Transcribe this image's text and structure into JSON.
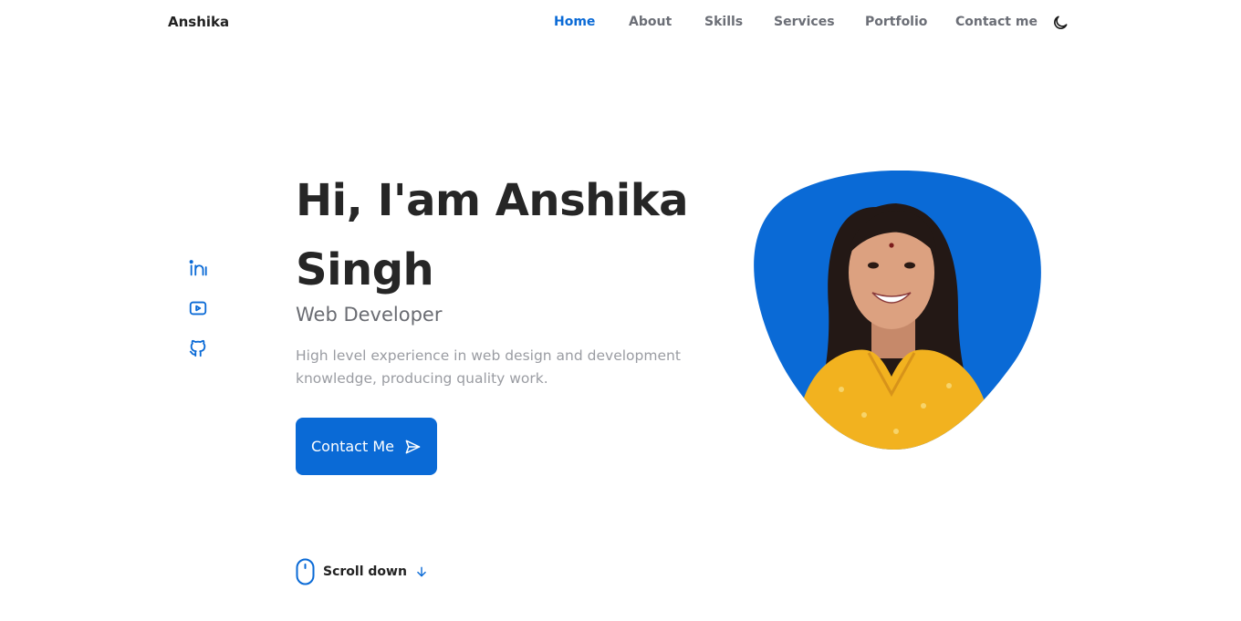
{
  "header": {
    "logo": "Anshika",
    "nav": [
      {
        "label": "Home",
        "active": true
      },
      {
        "label": "About",
        "active": false
      },
      {
        "label": "Skills",
        "active": false
      },
      {
        "label": "Services",
        "active": false
      },
      {
        "label": "Portfolio",
        "active": false
      },
      {
        "label": "Contact me",
        "active": false
      }
    ],
    "theme_icon": "moon-icon"
  },
  "socials": [
    {
      "icon": "linkedin-icon"
    },
    {
      "icon": "youtube-icon"
    },
    {
      "icon": "github-icon"
    }
  ],
  "hero": {
    "title_line1": "Hi, I'am Anshika",
    "title_line2": "Singh",
    "subtitle": "Web Developer",
    "description": "High level experience in web design and development knowledge, producing quality work.",
    "cta_label": "Contact Me",
    "cta_icon": "send-icon",
    "scroll_label": "Scroll down",
    "scroll_icons": [
      "mouse-icon",
      "arrow-down-icon"
    ]
  },
  "colors": {
    "accent": "#0a6ad6",
    "text_dark": "#262626",
    "text_muted": "#6a6c72",
    "text_light": "#9a9ca2",
    "photo_shirt": "#f2b21f"
  }
}
